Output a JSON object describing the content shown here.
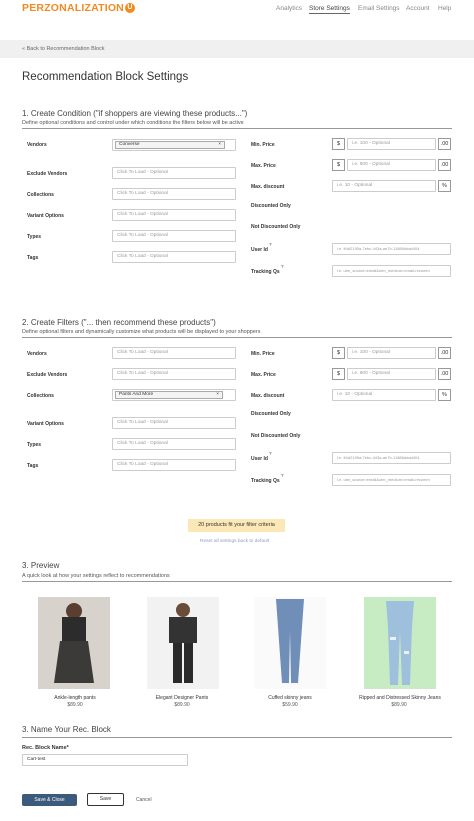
{
  "header": {
    "logo_text": "PERZONALIZATION",
    "logo_badge": "U",
    "nav": [
      "Analytics",
      "Store Settings",
      "Email Settings",
      "Account",
      "Help"
    ],
    "active_nav": "Store Settings"
  },
  "back_link": "« Back to Recommendation Block",
  "page_title": "Recommendation Block Settings",
  "condition": {
    "title": "1. Create Condition (\"if shoppers are viewing these products...\")",
    "desc": "Define optional conditions and control under which conditions the filters below will be active",
    "left": [
      {
        "label": "Vendors",
        "tag": "Converse"
      },
      {
        "label": "Exclude Vendors",
        "placeholder": "Click To Load - Optional"
      },
      {
        "label": "Collections",
        "placeholder": "Click To Load - Optional"
      },
      {
        "label": "Variant Options",
        "placeholder": "Click To Load - Optional"
      },
      {
        "label": "Types",
        "placeholder": "Click To Load - Optional"
      },
      {
        "label": "Tags",
        "placeholder": "Click To Load - Optional"
      }
    ],
    "min_price": {
      "label": "Min. Price",
      "prefix": "$",
      "placeholder": "i.e. 100 - Optional",
      "suffix": ".00"
    },
    "max_price": {
      "label": "Max. Price",
      "prefix": "$",
      "placeholder": "i.e. 600 - Optional",
      "suffix": ".00"
    },
    "max_discount": {
      "label": "Max. discount",
      "placeholder": "i.e. 10 - Optional",
      "suffix": "%"
    },
    "discounted_only": "Discounted Only",
    "not_discounted_only": "Not Discounted Only",
    "user_id": {
      "label": "User Id",
      "placeholder": "i.e. ft4d2195a-7ebc-443a-ae7b-11888ddad404"
    },
    "tracking": {
      "label": "Tracking Qs",
      "placeholder": "i.e. utm_source=email&utm_medium=email-recomm"
    }
  },
  "filters": {
    "title": "2. Create Filters (\"... then recommend these products\")",
    "desc": "Define optional filters and dynamically customize what products will be displayed to your shoppers",
    "left": [
      {
        "label": "Vendors",
        "placeholder": "Click To Load - Optional"
      },
      {
        "label": "Exclude Vendors",
        "placeholder": "Click To Load - Optional"
      },
      {
        "label": "Collections",
        "tag": "Pants And More"
      },
      {
        "label": "Variant Options",
        "placeholder": "Click To Load - Optional"
      },
      {
        "label": "Types",
        "placeholder": "Click To Load - Optional"
      },
      {
        "label": "Tags",
        "placeholder": "Click To Load - Optional"
      }
    ],
    "min_price": {
      "label": "Min. Price",
      "prefix": "$",
      "placeholder": "i.e. 100 - Optional",
      "suffix": ".00"
    },
    "max_price": {
      "label": "Max. Price",
      "prefix": "$",
      "placeholder": "i.e. 600 - Optional",
      "suffix": ".00"
    },
    "max_discount": {
      "label": "Max. discount",
      "placeholder": "i.e. 10 - Optional",
      "suffix": "%"
    },
    "discounted_only": "Discounted Only",
    "not_discounted_only": "Not Discounted Only",
    "user_id": {
      "label": "User Id",
      "placeholder": "i.e. ft4d2195a-7ebc-443a-ae7b-11888ddad404"
    },
    "tracking": {
      "label": "Tracking Qs",
      "placeholder": "i.e. utm_source=email&utm_medium=email-recomm"
    },
    "result_banner": "20 products fit your filter criteria",
    "reset_link": "Reset all settings back to default"
  },
  "preview": {
    "title": "3. Preview",
    "desc": "A quick look at how your settings reflect to recommendations",
    "products": [
      {
        "name": "Ankle-length pants",
        "price": "$89.90"
      },
      {
        "name": "Elegant Designer Pants",
        "price": "$89.90"
      },
      {
        "name": "Cuffed skinny jeans",
        "price": "$59.90"
      },
      {
        "name": "Ripped and Distressed Skinny Jeans",
        "price": "$89.90"
      }
    ]
  },
  "name_block": {
    "title": "3. Name Your Rec. Block",
    "label": "Rec. Block Name*",
    "value": "Cart-test"
  },
  "actions": {
    "save_close": "Save & Close",
    "save": "Save",
    "cancel": "Cancel"
  },
  "colors": {
    "brand": "#f28a1e",
    "primary_button": "#3c5a7c",
    "banner": "#fbe8b6"
  }
}
